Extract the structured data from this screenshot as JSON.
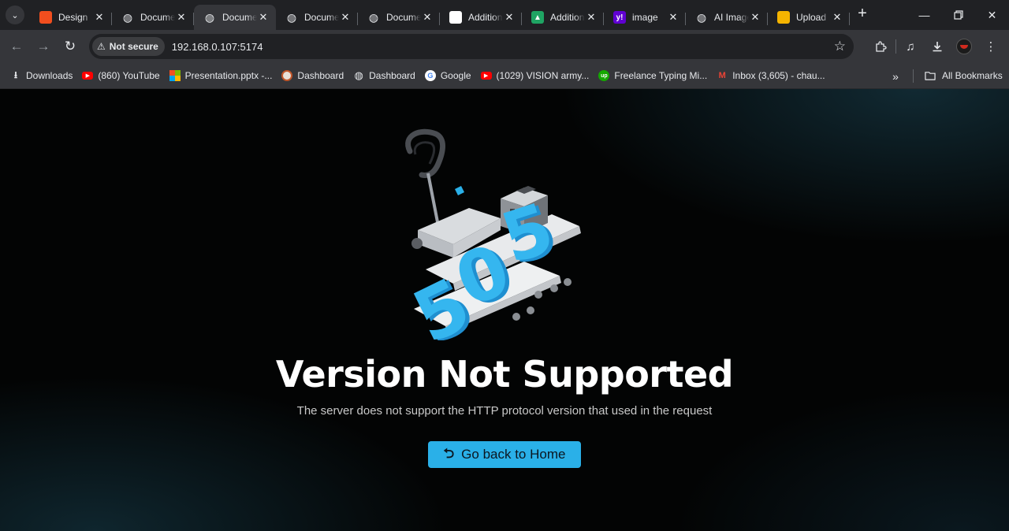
{
  "tabs": [
    {
      "title": "Design",
      "favicon": "figma-icon",
      "color": "#f24e1e",
      "glyph": "",
      "active": false
    },
    {
      "title": "Document",
      "favicon": "globe-icon",
      "color": "#5f6368",
      "glyph": "◍",
      "active": false
    },
    {
      "title": "Document",
      "favicon": "globe-icon",
      "color": "#5f6368",
      "glyph": "◍",
      "active": true
    },
    {
      "title": "Document",
      "favicon": "globe-icon",
      "color": "#5f6368",
      "glyph": "◍",
      "active": false
    },
    {
      "title": "Document",
      "favicon": "globe-icon",
      "color": "#5f6368",
      "glyph": "◍",
      "active": false
    },
    {
      "title": "Additional",
      "favicon": "app-icon",
      "color": "#ffffff",
      "glyph": "",
      "active": false
    },
    {
      "title": "Additional",
      "favicon": "google-drive-icon",
      "color": "#1fa463",
      "glyph": "▲",
      "active": false
    },
    {
      "title": "image",
      "favicon": "yahoo-icon",
      "color": "#6001d2",
      "glyph": "y!",
      "active": false
    },
    {
      "title": "AI Image",
      "favicon": "globe-icon",
      "color": "#5f6368",
      "glyph": "◍",
      "active": false
    },
    {
      "title": "Upload",
      "favicon": "upload-icon",
      "color": "#f5b400",
      "glyph": "",
      "active": false
    }
  ],
  "toolbar": {
    "security_label": "Not secure",
    "url": "192.168.0.107:5174"
  },
  "bookmarks": [
    {
      "label": "Downloads",
      "icon": "download-icon",
      "color": "#35363a",
      "glyph": "⭳"
    },
    {
      "label": "(860) YouTube",
      "icon": "youtube-icon",
      "color": "#ff0000",
      "glyph": "▶"
    },
    {
      "label": "Presentation.pptx -...",
      "icon": "microsoft-icon",
      "color": "#f25022",
      "glyph": ""
    },
    {
      "label": "Dashboard",
      "icon": "dashboard-icon",
      "color": "#e8e0d8",
      "glyph": ""
    },
    {
      "label": "Dashboard",
      "icon": "globe-icon",
      "color": "#5f6368",
      "glyph": "◍"
    },
    {
      "label": "Google",
      "icon": "google-icon",
      "color": "#ffffff",
      "glyph": "G"
    },
    {
      "label": "(1029) VISION army...",
      "icon": "youtube-icon",
      "color": "#ff0000",
      "glyph": "▶"
    },
    {
      "label": "Freelance Typing Mi...",
      "icon": "upwork-icon",
      "color": "#14a800",
      "glyph": "up"
    },
    {
      "label": "Inbox (3,605) - chau...",
      "icon": "gmail-icon",
      "color": "#35363a",
      "glyph": "M"
    }
  ],
  "all_bookmarks_label": "All Bookmarks",
  "error": {
    "illustration_text": "505",
    "title": "Version Not Supported",
    "message": "The server does not support the HTTP protocol version that used in the request",
    "button_label": "Go back to Home",
    "accent_color": "#2ab0e8"
  }
}
